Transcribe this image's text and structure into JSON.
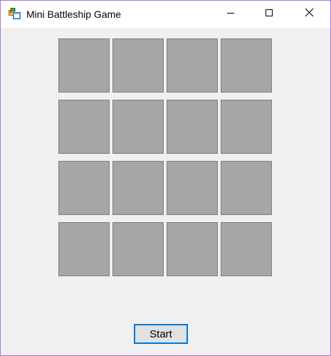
{
  "window": {
    "title": "Mini Battleship Game",
    "app_icon": "windows-form-icon",
    "controls": [
      "minimize-icon",
      "maximize-icon",
      "close-icon"
    ]
  },
  "board": {
    "rows": 4,
    "cols": 4,
    "cell_color": "#a6a6a6",
    "cell_border_color": "#7f7f7f"
  },
  "start_button": {
    "label": "Start",
    "focus_border_color": "#0078d7"
  },
  "colors": {
    "window_background": "#f0f0f0",
    "titlebar_background": "#ffffff",
    "window_border": "#a678d8"
  }
}
